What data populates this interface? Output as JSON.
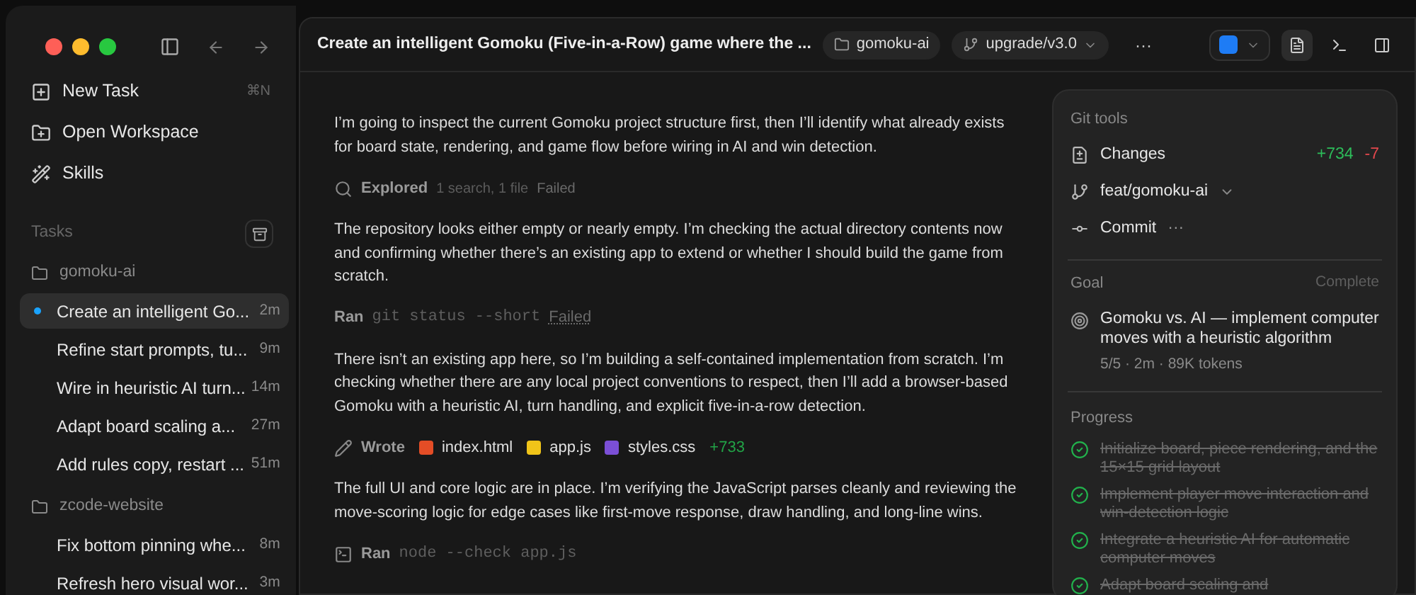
{
  "sidebar": {
    "menu": [
      {
        "kind": "new",
        "label": "New Task",
        "shortcut": "⌘N"
      },
      {
        "kind": "open",
        "label": "Open Workspace"
      },
      {
        "kind": "skills",
        "label": "Skills"
      }
    ],
    "tasks_title": "Tasks",
    "groups": [
      {
        "name": "gomoku-ai",
        "tasks": [
          {
            "title": "Create an intelligent Go...",
            "time": "2m",
            "selected": true
          },
          {
            "title": "Refine start prompts, tu...",
            "time": "9m",
            "selected": false
          },
          {
            "title": "Wire in heuristic AI turn...",
            "time": "14m",
            "selected": false
          },
          {
            "title": "Adapt board scaling a...",
            "time": "27m",
            "selected": false
          },
          {
            "title": "Add rules copy, restart ...",
            "time": "51m",
            "selected": false
          }
        ]
      },
      {
        "name": "zcode-website",
        "tasks": [
          {
            "title": "Fix bottom pinning whe...",
            "time": "8m",
            "selected": false
          },
          {
            "title": "Refresh hero visual wor...",
            "time": "3m",
            "selected": false
          }
        ]
      }
    ]
  },
  "header": {
    "title": "Create an intelligent Gomoku (Five-in-a-Row) game where the ...",
    "folder": "gomoku-ai",
    "branch": "upgrade/v3.0",
    "more": "···",
    "tools": [
      {
        "kind": "editor",
        "selected": true
      },
      {
        "kind": "terminal",
        "selected": false
      },
      {
        "kind": "panel",
        "selected": false
      }
    ]
  },
  "chat": [
    {
      "kind": "text",
      "text": "I’m going to inspect the current Gomoku project structure first, then I’ll identify what already exists for board state, rendering, and game flow before wiring in AI and win detection."
    },
    {
      "kind": "explore",
      "action": "Explored",
      "detail": "1 search, 1 file",
      "status": "Failed"
    },
    {
      "kind": "text",
      "text": "The repository looks either empty or nearly empty. I’m checking the actual directory contents now and confirming whether there’s an existing app to extend or whether I should build the game from scratch."
    },
    {
      "kind": "command",
      "action": "Ran",
      "command": "git status --short",
      "status": "Failed"
    },
    {
      "kind": "text",
      "text": "There isn’t an existing app here, so I’m building a self-contained implementation from scratch. I’m checking whether there are any local project conventions to respect, then I’ll add a browser-based Gomoku with a heuristic AI, turn handling, and explicit five-in-a-row detection."
    },
    {
      "kind": "write",
      "action": "Wrote",
      "files": [
        {
          "color": "#e44d26",
          "name": "index.html"
        },
        {
          "color": "#f0c419",
          "name": "app.js"
        },
        {
          "color": "#7b4fd6",
          "name": "styles.css"
        }
      ],
      "added": "+733"
    },
    {
      "kind": "text",
      "text": "The full UI and core logic are in place. I’m verifying the JavaScript parses cleanly and reviewing the move-scoring logic for edge cases like first-move response, draw handling, and long-line wins."
    },
    {
      "kind": "shell",
      "action": "Ran",
      "command": "node --check app.js"
    }
  ],
  "git_tools": {
    "title": "Git tools",
    "changes": "Changes",
    "added": "+734",
    "removed": "-7",
    "branch": "feat/gomoku-ai",
    "commit": "Commit",
    "commit_more": "···"
  },
  "goal": {
    "title": "Goal",
    "status": "Complete",
    "text": "Gomoku vs. AI — implement computer moves with a heuristic algorithm",
    "meta": "5/5 · 2m · 89K tokens"
  },
  "progress": {
    "title": "Progress",
    "items": [
      {
        "text": "Initialize board, piece rendering, and the 15×15 grid layout",
        "done": true
      },
      {
        "text": "Implement player move interaction and win-detection logic",
        "done": true
      },
      {
        "text": "Integrate a heuristic AI for automatic computer moves",
        "done": true
      },
      {
        "text": "Adapt board scaling and",
        "done": true
      }
    ]
  }
}
